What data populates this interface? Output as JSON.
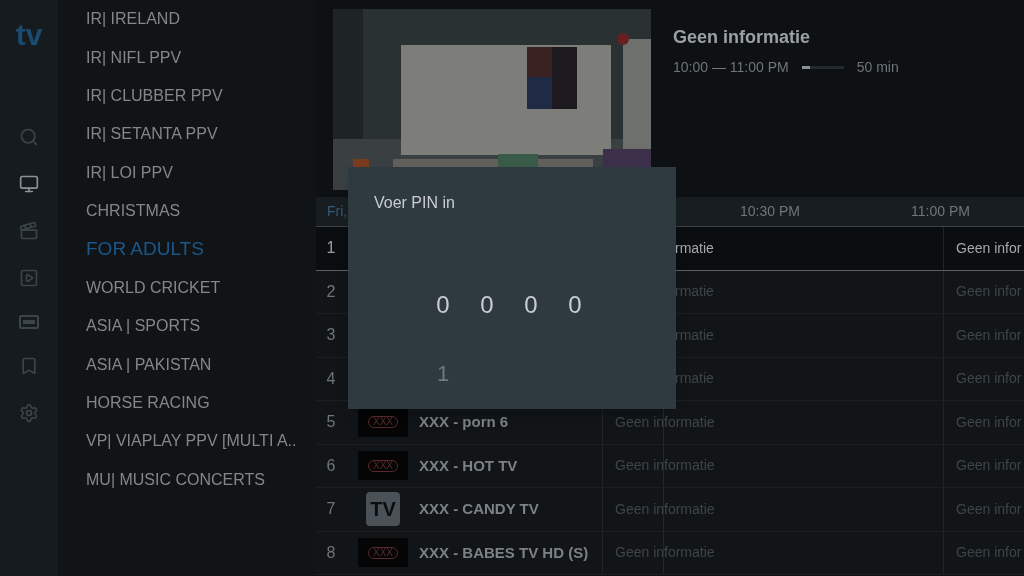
{
  "logo": "tv",
  "nav": [
    {
      "kind": "search",
      "selected": false
    },
    {
      "kind": "tv",
      "selected": true
    },
    {
      "kind": "movies",
      "selected": false
    },
    {
      "kind": "library",
      "selected": false
    },
    {
      "kind": "dvr",
      "selected": false
    },
    {
      "kind": "bookmark",
      "selected": false
    },
    {
      "kind": "settings",
      "selected": false
    }
  ],
  "categories": [
    {
      "label": "IR| IRELAND",
      "selected": false
    },
    {
      "label": "IR| NIFL PPV",
      "selected": false
    },
    {
      "label": "IR| CLUBBER PPV",
      "selected": false
    },
    {
      "label": "IR| SETANTA PPV",
      "selected": false
    },
    {
      "label": "IR| LOI PPV",
      "selected": false
    },
    {
      "label": "CHRISTMAS",
      "selected": false
    },
    {
      "label": "FOR ADULTS",
      "selected": true
    },
    {
      "label": "WORLD CRICKET",
      "selected": false
    },
    {
      "label": "ASIA | SPORTS",
      "selected": false
    },
    {
      "label": "ASIA | PAKISTAN",
      "selected": false
    },
    {
      "label": "HORSE RACING",
      "selected": false
    },
    {
      "label": "VP| VIAPLAY PPV [MULTI A..",
      "selected": false
    },
    {
      "label": "MU| MUSIC CONCERTS",
      "selected": false
    }
  ],
  "program_info": {
    "title": "Geen informatie",
    "time": "10:00 — 11:00 PM",
    "level": 0.2,
    "remaining": "50 min"
  },
  "timeline": {
    "day": "Fri,",
    "times": [
      "10:30 PM",
      "11:00 PM"
    ]
  },
  "channels": [
    {
      "number": "1",
      "selected": true,
      "programs": [
        {
          "title": "rmatie",
          "covered": true
        },
        {
          "title": "Geen infor",
          "covered": false
        }
      ]
    },
    {
      "number": "2",
      "selected": false,
      "programs": [
        {
          "title": "rmatie",
          "covered": true
        },
        {
          "title": "Geen infor",
          "covered": false
        }
      ]
    },
    {
      "number": "3",
      "selected": false,
      "programs": [
        {
          "title": "rmatie",
          "covered": true
        },
        {
          "title": "Geen infor",
          "covered": false
        }
      ]
    },
    {
      "number": "4",
      "selected": false,
      "programs": [
        {
          "title": "rmatie",
          "covered": true
        },
        {
          "title": "Geen infor",
          "covered": false
        }
      ]
    },
    {
      "number": "5",
      "selected": false,
      "logo": {
        "kind": "badge",
        "text": "XXX"
      },
      "name": "XXX - porn 6",
      "programs": [
        {
          "title": "Geen informatie",
          "covered": false
        },
        {
          "title": "Geen infor",
          "covered": false
        }
      ]
    },
    {
      "number": "6",
      "selected": false,
      "logo": {
        "kind": "badge",
        "text": "XXX"
      },
      "name": "XXX - HOT TV",
      "programs": [
        {
          "title": "Geen informatie",
          "covered": false
        },
        {
          "title": "Geen infor",
          "covered": false
        }
      ]
    },
    {
      "number": "7",
      "selected": false,
      "logo": {
        "kind": "tile",
        "text": "TV"
      },
      "name": "XXX - CANDY TV",
      "programs": [
        {
          "title": "Geen informatie",
          "covered": false
        },
        {
          "title": "Geen infor",
          "covered": false
        }
      ]
    },
    {
      "number": "8",
      "selected": false,
      "logo": {
        "kind": "badge",
        "text": "XXX"
      },
      "name": "XXX - BABES TV HD (S)",
      "programs": [
        {
          "title": "Geen informatie",
          "covered": false
        },
        {
          "title": "Geen infor",
          "covered": false
        }
      ]
    }
  ],
  "pin_dialog": {
    "title": "Voer PIN in",
    "digits": [
      "0",
      "0",
      "0",
      "0"
    ],
    "next_digit": "1"
  }
}
